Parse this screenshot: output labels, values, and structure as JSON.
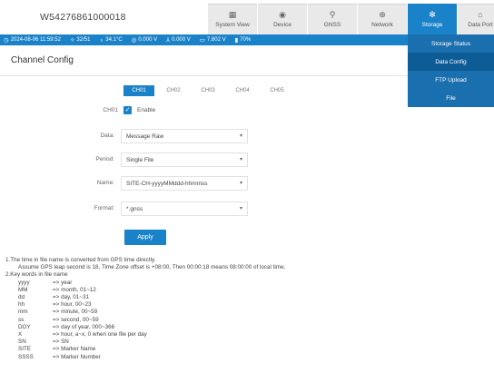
{
  "header": {
    "device_id": "W54276861000018",
    "nav": [
      {
        "label": "System View",
        "icon": "dashboard-icon",
        "glyph": "▦"
      },
      {
        "label": "Device",
        "icon": "satellite-icon",
        "glyph": "◉"
      },
      {
        "label": "GNSS",
        "icon": "location-pin-icon",
        "glyph": "⬤"
      },
      {
        "label": "Network",
        "icon": "network-icon",
        "glyph": "⊕"
      },
      {
        "label": "Storage",
        "icon": "storage-icon",
        "glyph": "✻"
      },
      {
        "label": "Data Port",
        "icon": "data-port-icon",
        "glyph": "⌂"
      }
    ],
    "active_nav": "Storage",
    "accent_color": "#1a82c8"
  },
  "status": {
    "datetime": "2024-08-06 11:59:52",
    "sats": "32/51",
    "temperature": "34.1°C",
    "voltage_a": "0.000 V",
    "voltage_b": "0.000 V",
    "power": "7.802 V",
    "battery": "70%"
  },
  "storage_menu": {
    "items": [
      "Storage Status",
      "Data Config",
      "FTP Upload",
      "File"
    ],
    "active": "Data Config"
  },
  "page": {
    "title": "Channel Config"
  },
  "tabs": [
    "CH01",
    "CH02",
    "CH03",
    "CH04",
    "CH05"
  ],
  "active_tab": "CH01",
  "form": {
    "channel_label": "CH01",
    "enable_label": "Enable",
    "enabled": true,
    "data_label": "Data:",
    "data_value": "Message Raw",
    "period_label": "Period:",
    "period_value": "Single File",
    "name_label": "Name:",
    "name_value": "SITE-CH-yyyyMMddd-hhmmss",
    "format_label": "Format:",
    "format_value": "*.gnss",
    "apply_label": "Apply"
  },
  "notes": {
    "line1": "1.The time in file name is converted from GPS time directly.",
    "line2": "Assume GPS leap second is 18, Time Zone offset is +08:00, Then 00:00:18 means 08:00:00 of local time.",
    "line3": "2.Key words in file name",
    "keywords": [
      {
        "key": "yyyy",
        "desc": "=> year"
      },
      {
        "key": "MM",
        "desc": "=> month, 01~12"
      },
      {
        "key": "dd",
        "desc": "=> day, 01~31"
      },
      {
        "key": "hh",
        "desc": "=> hour, 00~23"
      },
      {
        "key": "mm",
        "desc": "=> minute, 00~59"
      },
      {
        "key": "ss",
        "desc": "=> second, 00~59"
      },
      {
        "key": "DOY",
        "desc": "=> day of year, 000~366"
      },
      {
        "key": "X",
        "desc": "=> hour, a~x, 0 when one file per day"
      },
      {
        "key": "SN",
        "desc": "=> SN"
      },
      {
        "key": "SITE",
        "desc": "=> Marker Name"
      },
      {
        "key": "SSSS",
        "desc": "=> Marker Number"
      }
    ]
  }
}
